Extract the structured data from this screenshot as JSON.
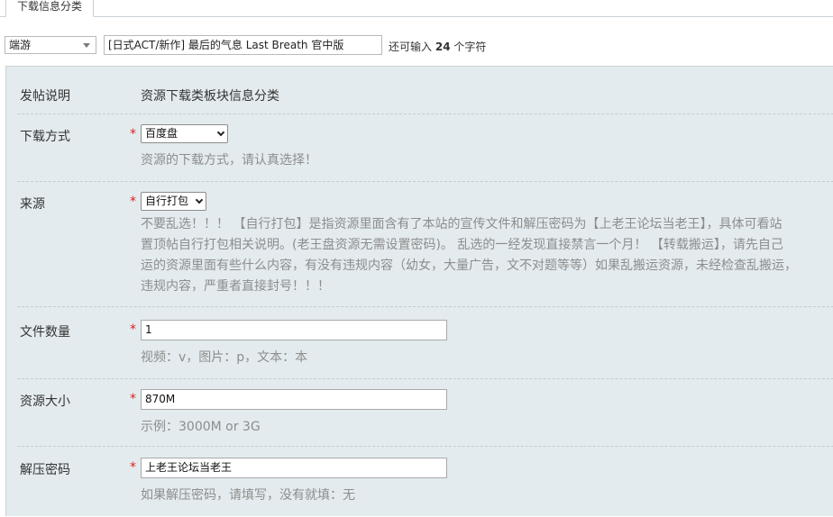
{
  "tab": {
    "label": "下载信息分类"
  },
  "title_row": {
    "type_select_value": "端游",
    "title_value": "[日式ACT/新作] 最后的气息 Last Breath 官中版",
    "char_count_prefix": "还可输入",
    "char_count_number": "24",
    "char_count_suffix": "个字符"
  },
  "form": {
    "description": {
      "label": "发帖说明",
      "value": "资源下载类板块信息分类"
    },
    "download_method": {
      "label": "下载方式",
      "required_mark": "*",
      "selected": "百度盘",
      "hint": "资源的下载方式，请认真选择！"
    },
    "source": {
      "label": "来源",
      "required_mark": "*",
      "selected": "自行打包",
      "hint_lines": [
        "不要乱选！！！ 【自行打包】是指资源里面含有了本站的宣传文件和解压密码为【上老王论坛当老王】，具体可看站",
        "置顶帖自行打包相关说明。(老王盘资源无需设置密码)。 乱选的一经发现直接禁言一个月！ 【转载搬运】，请先自己",
        "运的资源里面有些什么内容，有没有违规内容（幼女，大量广告，文不对题等等）如果乱搬运资源，未经检查乱搬运，",
        "违规内容，严重者直接封号！！！"
      ]
    },
    "file_count": {
      "label": "文件数量",
      "required_mark": "*",
      "value": "1",
      "hint": "视频：v，图片：p，文本：本"
    },
    "resource_size": {
      "label": "资源大小",
      "required_mark": "*",
      "value": "870M",
      "hint": "示例：3000M or 3G"
    },
    "unzip_password": {
      "label": "解压密码",
      "required_mark": "*",
      "value": "上老王论坛当老王",
      "hint": "如果解压密码，请填写，没有就填：无"
    }
  }
}
